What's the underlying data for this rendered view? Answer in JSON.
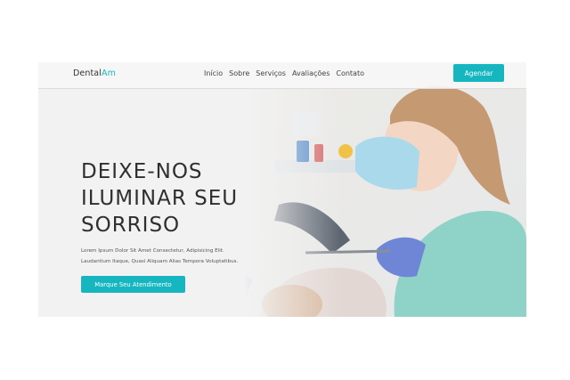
{
  "header": {
    "logo_prefix": "Dental",
    "logo_suffix": "Am",
    "nav": [
      "Início",
      "Sobre",
      "Serviços",
      "Avaliações",
      "Contato"
    ],
    "cta_label": "Agendar"
  },
  "hero": {
    "headline": [
      "DEIXE-NOS",
      "ILUMINAR SEU",
      "SORRISO"
    ],
    "description": [
      "Lorem Ipsum Dolor Sit Amet Consectetur, Adipisicing Elit.",
      "Laudantium Itaque, Quasi Aliquam Alias Tempora Voluptatibus."
    ],
    "button_label": "Marque Seu Atendimento"
  },
  "colors": {
    "accent": "#16b6c0",
    "background": "#f2f2f2"
  },
  "icons": [
    "dentist-illustration"
  ]
}
